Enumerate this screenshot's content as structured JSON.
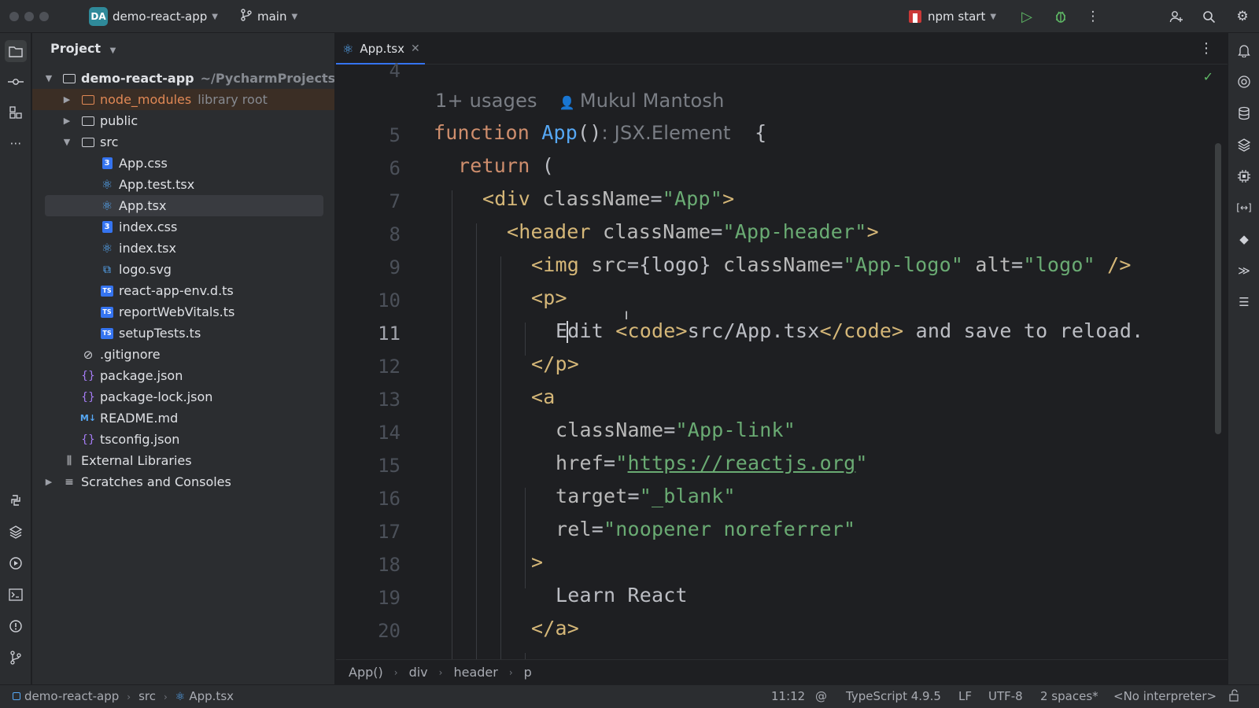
{
  "titlebar": {
    "project_badge": "DA",
    "project_name": "demo-react-app",
    "branch": "main",
    "run_config": "npm start"
  },
  "project_panel": {
    "title": "Project",
    "tree": [
      {
        "name": "demo-react-app",
        "extra": "~/PycharmProjects/der",
        "type": "folder",
        "bold": true
      },
      {
        "name": "node_modules",
        "extra": "library root",
        "type": "folder-orange"
      },
      {
        "name": "public",
        "type": "folder"
      },
      {
        "name": "src",
        "type": "folder"
      },
      {
        "name": "App.css",
        "type": "css"
      },
      {
        "name": "App.test.tsx",
        "type": "react"
      },
      {
        "name": "App.tsx",
        "type": "react",
        "selected": true
      },
      {
        "name": "index.css",
        "type": "css"
      },
      {
        "name": "index.tsx",
        "type": "react"
      },
      {
        "name": "logo.svg",
        "type": "svg"
      },
      {
        "name": "react-app-env.d.ts",
        "type": "ts"
      },
      {
        "name": "reportWebVitals.ts",
        "type": "ts"
      },
      {
        "name": "setupTests.ts",
        "type": "ts"
      },
      {
        "name": ".gitignore",
        "type": "ignore"
      },
      {
        "name": "package.json",
        "type": "json"
      },
      {
        "name": "package-lock.json",
        "type": "json"
      },
      {
        "name": "README.md",
        "type": "md"
      },
      {
        "name": "tsconfig.json",
        "type": "json"
      },
      {
        "name": "External Libraries",
        "type": "lib"
      },
      {
        "name": "Scratches and Consoles",
        "type": "scratch"
      }
    ]
  },
  "editor": {
    "tab_label": "App.tsx",
    "top_line_number": "4",
    "usages_hint": "1+ usages",
    "author_hint": "Mukul Mantosh",
    "type_hint": ": JSX.Element",
    "line_numbers": [
      "5",
      "6",
      "7",
      "8",
      "9",
      "10",
      "11",
      "12",
      "13",
      "14",
      "15",
      "16",
      "17",
      "18",
      "19",
      "20"
    ]
  },
  "breadcrumbs": [
    "App()",
    "div",
    "header",
    "p"
  ],
  "statusbar": {
    "path": [
      "demo-react-app",
      "src",
      "App.tsx"
    ],
    "position": "11:12",
    "language": "TypeScript 4.9.5",
    "line_sep": "LF",
    "encoding": "UTF-8",
    "indent": "2 spaces*",
    "interpreter": "<No interpreter>"
  }
}
